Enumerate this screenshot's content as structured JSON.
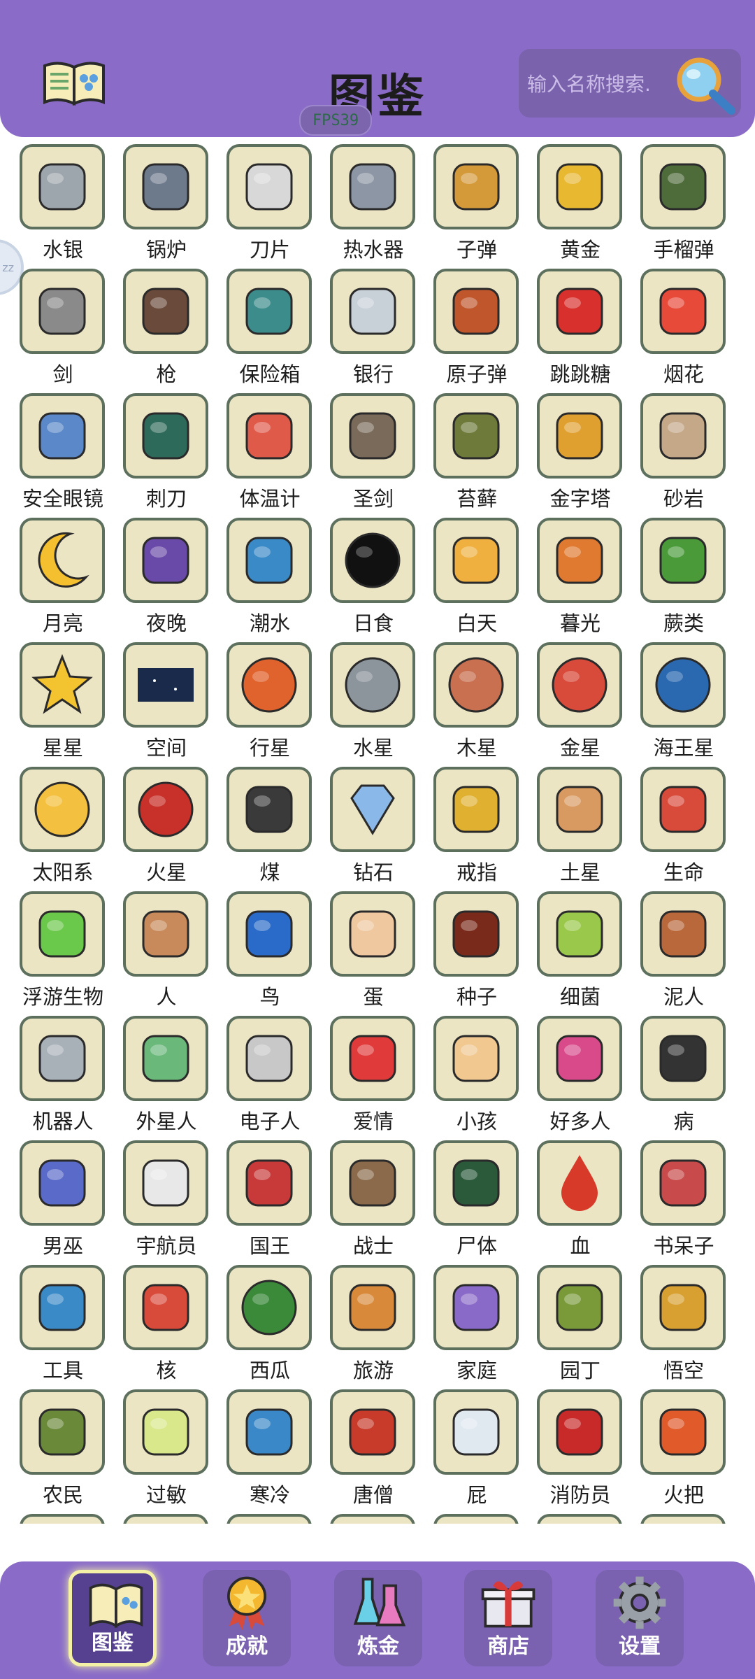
{
  "header": {
    "title": "图鉴",
    "fps": "FPS39",
    "search_placeholder": "输入名称搜索.",
    "book_icon": "book-icon",
    "search_icon": "magnifier-icon",
    "colors": {
      "bar": "#8a6cc8",
      "tile": "#ece5c4",
      "tile_border": "#5d6f5d",
      "active": "#f4f1a6"
    }
  },
  "items": [
    {
      "label": "水银",
      "icon": "mercury-icon"
    },
    {
      "label": "锅炉",
      "icon": "boiler-icon"
    },
    {
      "label": "刀片",
      "icon": "blade-icon"
    },
    {
      "label": "热水器",
      "icon": "water-heater-icon"
    },
    {
      "label": "子弹",
      "icon": "bullet-icon"
    },
    {
      "label": "黄金",
      "icon": "gold-icon"
    },
    {
      "label": "手榴弹",
      "icon": "grenade-icon"
    },
    {
      "label": "剑",
      "icon": "sword-icon"
    },
    {
      "label": "枪",
      "icon": "gun-icon"
    },
    {
      "label": "保险箱",
      "icon": "safe-icon"
    },
    {
      "label": "银行",
      "icon": "bank-icon"
    },
    {
      "label": "原子弹",
      "icon": "nuke-icon"
    },
    {
      "label": "跳跳糖",
      "icon": "pop-rocks-icon"
    },
    {
      "label": "烟花",
      "icon": "fireworks-icon"
    },
    {
      "label": "安全眼镜",
      "icon": "goggles-icon"
    },
    {
      "label": "刺刀",
      "icon": "bayonet-icon"
    },
    {
      "label": "体温计",
      "icon": "thermometer-icon"
    },
    {
      "label": "圣剑",
      "icon": "holy-sword-icon"
    },
    {
      "label": "苔藓",
      "icon": "moss-icon"
    },
    {
      "label": "金字塔",
      "icon": "pyramid-icon"
    },
    {
      "label": "砂岩",
      "icon": "sandstone-icon"
    },
    {
      "label": "月亮",
      "icon": "moon-icon"
    },
    {
      "label": "夜晚",
      "icon": "night-icon"
    },
    {
      "label": "潮水",
      "icon": "tide-icon"
    },
    {
      "label": "日食",
      "icon": "eclipse-icon"
    },
    {
      "label": "白天",
      "icon": "day-icon"
    },
    {
      "label": "暮光",
      "icon": "twilight-icon"
    },
    {
      "label": "蕨类",
      "icon": "fern-icon"
    },
    {
      "label": "星星",
      "icon": "star-icon"
    },
    {
      "label": "空间",
      "icon": "space-icon"
    },
    {
      "label": "行星",
      "icon": "planet-icon"
    },
    {
      "label": "水星",
      "icon": "mercury-planet-icon"
    },
    {
      "label": "木星",
      "icon": "jupiter-icon"
    },
    {
      "label": "金星",
      "icon": "venus-icon"
    },
    {
      "label": "海王星",
      "icon": "neptune-icon"
    },
    {
      "label": "太阳系",
      "icon": "solar-system-icon"
    },
    {
      "label": "火星",
      "icon": "mars-icon"
    },
    {
      "label": "煤",
      "icon": "coal-icon"
    },
    {
      "label": "钻石",
      "icon": "diamond-icon"
    },
    {
      "label": "戒指",
      "icon": "ring-icon"
    },
    {
      "label": "土星",
      "icon": "saturn-icon"
    },
    {
      "label": "生命",
      "icon": "dna-icon"
    },
    {
      "label": "浮游生物",
      "icon": "plankton-icon"
    },
    {
      "label": "人",
      "icon": "human-icon"
    },
    {
      "label": "鸟",
      "icon": "bird-icon"
    },
    {
      "label": "蛋",
      "icon": "egg-icon"
    },
    {
      "label": "种子",
      "icon": "seed-icon"
    },
    {
      "label": "细菌",
      "icon": "bacteria-icon"
    },
    {
      "label": "泥人",
      "icon": "golem-icon"
    },
    {
      "label": "机器人",
      "icon": "robot-icon"
    },
    {
      "label": "外星人",
      "icon": "alien-icon"
    },
    {
      "label": "电子人",
      "icon": "cyborg-icon"
    },
    {
      "label": "爱情",
      "icon": "love-icon"
    },
    {
      "label": "小孩",
      "icon": "baby-icon"
    },
    {
      "label": "好多人",
      "icon": "crowd-icon"
    },
    {
      "label": "病",
      "icon": "sickness-icon"
    },
    {
      "label": "男巫",
      "icon": "wizard-icon"
    },
    {
      "label": "宇航员",
      "icon": "astronaut-icon"
    },
    {
      "label": "国王",
      "icon": "king-icon"
    },
    {
      "label": "战士",
      "icon": "warrior-icon"
    },
    {
      "label": "尸体",
      "icon": "corpse-icon"
    },
    {
      "label": "血",
      "icon": "blood-icon"
    },
    {
      "label": "书呆子",
      "icon": "nerd-icon"
    },
    {
      "label": "工具",
      "icon": "tools-icon"
    },
    {
      "label": "核",
      "icon": "apple-core-icon"
    },
    {
      "label": "西瓜",
      "icon": "watermelon-icon"
    },
    {
      "label": "旅游",
      "icon": "traveler-icon"
    },
    {
      "label": "家庭",
      "icon": "family-icon"
    },
    {
      "label": "园丁",
      "icon": "gardener-icon"
    },
    {
      "label": "悟空",
      "icon": "wukong-icon"
    },
    {
      "label": "农民",
      "icon": "farmer-icon"
    },
    {
      "label": "过敏",
      "icon": "allergy-icon"
    },
    {
      "label": "寒冷",
      "icon": "cold-icon"
    },
    {
      "label": "唐僧",
      "icon": "monk-icon"
    },
    {
      "label": "屁",
      "icon": "fart-icon"
    },
    {
      "label": "消防员",
      "icon": "firefighter-icon"
    },
    {
      "label": "火把",
      "icon": "torch-icon"
    }
  ],
  "nav": [
    {
      "label": "图鉴",
      "icon": "book-icon",
      "active": true
    },
    {
      "label": "成就",
      "icon": "medal-icon",
      "active": false
    },
    {
      "label": "炼金",
      "icon": "flask-icon",
      "active": false
    },
    {
      "label": "商店",
      "icon": "gift-icon",
      "active": false
    },
    {
      "label": "设置",
      "icon": "gear-icon",
      "active": false
    }
  ]
}
